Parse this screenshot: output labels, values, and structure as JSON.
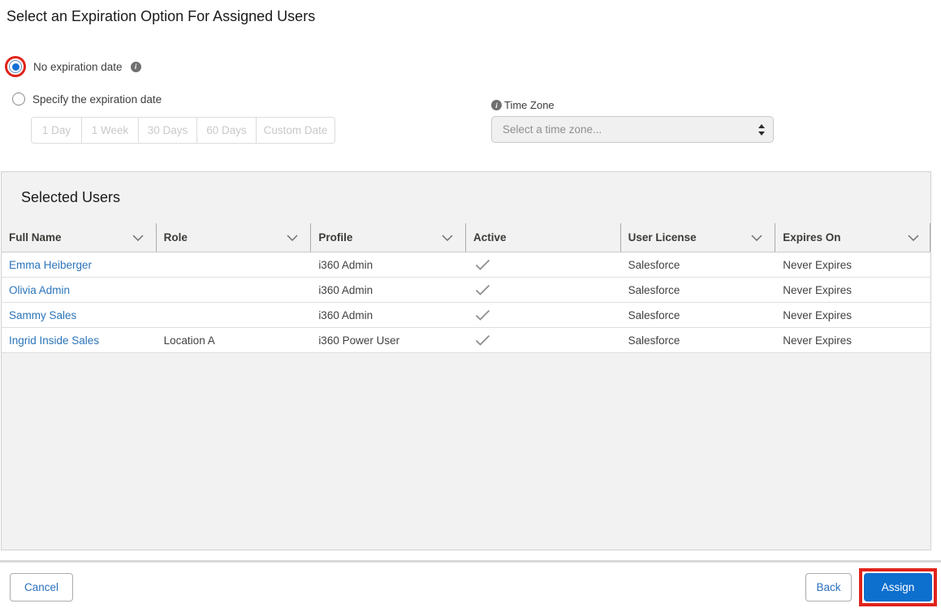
{
  "page": {
    "title": "Select an Expiration Option For Assigned Users"
  },
  "options": {
    "no_expiration_label": "No expiration date",
    "specify_label": "Specify the expiration date",
    "durations": [
      "1 Day",
      "1 Week",
      "30 Days",
      "60 Days",
      "Custom Date"
    ],
    "time_zone_label": "Time Zone",
    "time_zone_placeholder": "Select a time zone...",
    "selected_option": "No expiration date"
  },
  "icons": {
    "info_glyph": "i"
  },
  "selected_users": {
    "heading": "Selected Users",
    "columns": [
      {
        "label": "Full Name",
        "menu": true
      },
      {
        "label": "Role",
        "menu": true
      },
      {
        "label": "Profile",
        "menu": true
      },
      {
        "label": "Active",
        "menu": false
      },
      {
        "label": "User License",
        "menu": true
      },
      {
        "label": "Expires On",
        "menu": true
      }
    ],
    "rows": [
      {
        "full_name": "Emma Heiberger",
        "role": "",
        "profile": "i360 Admin",
        "active": true,
        "user_license": "Salesforce",
        "expires_on": "Never Expires"
      },
      {
        "full_name": "Olivia Admin",
        "role": "",
        "profile": "i360 Admin",
        "active": true,
        "user_license": "Salesforce",
        "expires_on": "Never Expires"
      },
      {
        "full_name": "Sammy Sales",
        "role": "",
        "profile": "i360 Admin",
        "active": true,
        "user_license": "Salesforce",
        "expires_on": "Never Expires"
      },
      {
        "full_name": "Ingrid Inside Sales",
        "role": "Location A",
        "profile": "i360 Power User",
        "active": true,
        "user_license": "Salesforce",
        "expires_on": "Never Expires"
      }
    ]
  },
  "footer": {
    "cancel_label": "Cancel",
    "back_label": "Back",
    "assign_label": "Assign"
  },
  "colors": {
    "accent_blue": "#0d6fce",
    "link_blue": "#2b74b9",
    "annotation_red": "#e0231b",
    "panel_gray": "#f2f2f2"
  },
  "annotations": {
    "no_expiration_radio_circled": true,
    "assign_button_boxed": true
  }
}
